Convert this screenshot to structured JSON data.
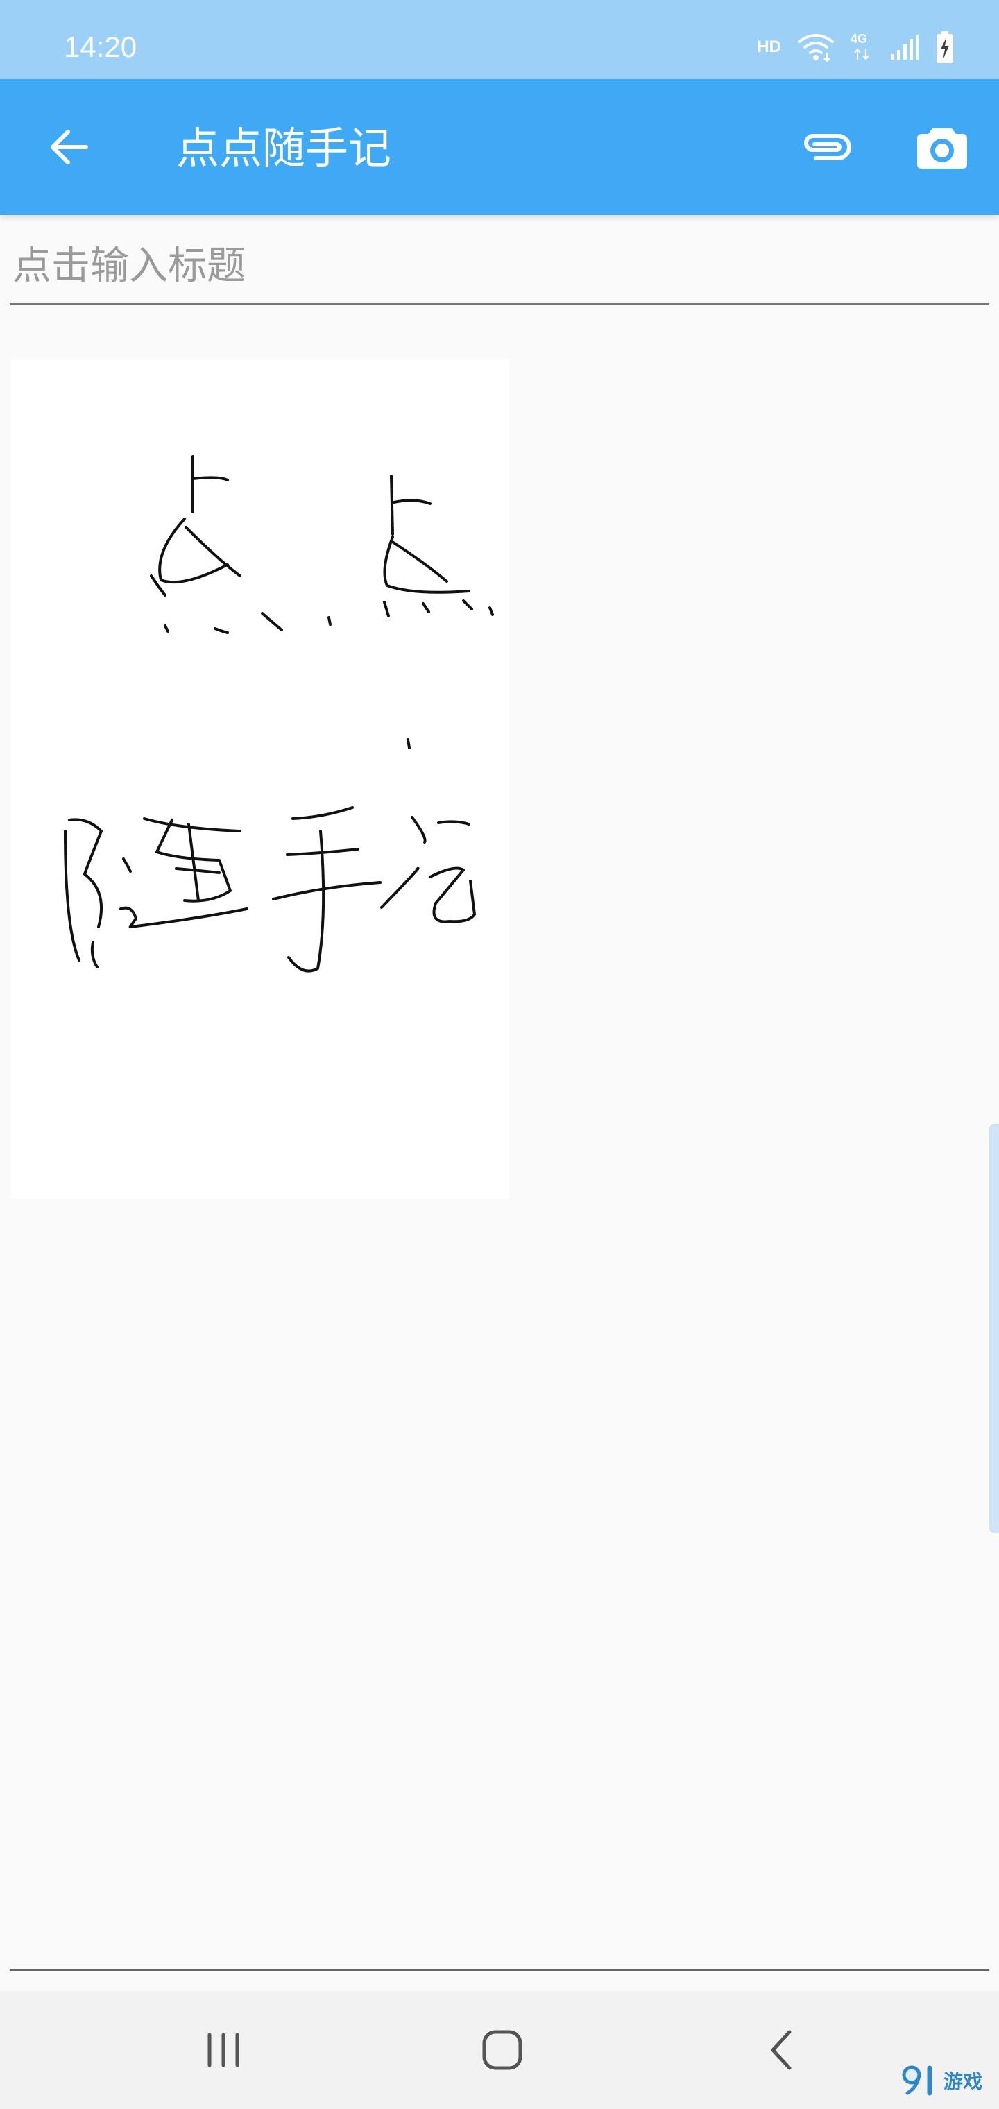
{
  "status_bar": {
    "time": "14:20",
    "hd_label": "HD",
    "network_label": "4G"
  },
  "app_bar": {
    "title": "点点随手记"
  },
  "editor": {
    "title_placeholder": "点击输入标题",
    "title_value": ""
  },
  "watermark": {
    "text": "游戏"
  },
  "colors": {
    "primary": "#3fa9f5",
    "status_bar": "#9dd0f6",
    "background": "#fafafa"
  }
}
